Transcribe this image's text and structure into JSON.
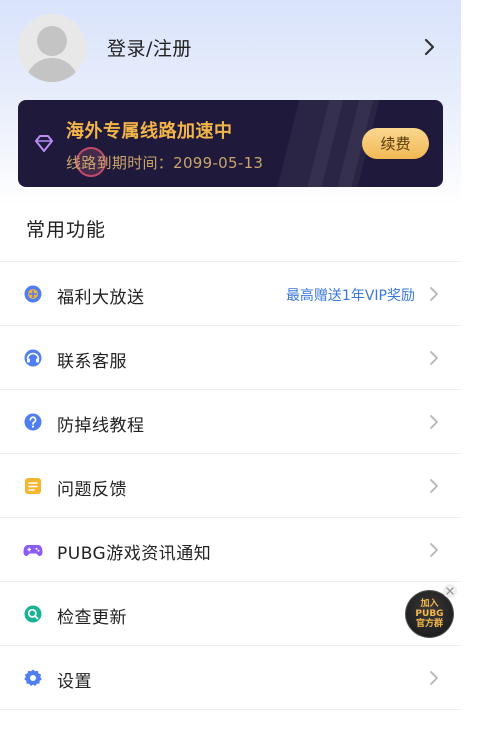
{
  "header": {
    "login_label": "登录/注册"
  },
  "vip_banner": {
    "title": "海外专属线路加速中",
    "expiry": "线路到期时间：2099-05-13",
    "renew_label": "续费"
  },
  "section": {
    "title": "常用功能"
  },
  "menu": [
    {
      "label": "福利大放送",
      "extra": "最高赠送1年VIP奖励",
      "icon": "gift-globe-icon"
    },
    {
      "label": "联系客服",
      "icon": "customer-service-icon"
    },
    {
      "label": "防掉线教程",
      "icon": "help-question-icon"
    },
    {
      "label": "问题反馈",
      "icon": "feedback-note-icon"
    },
    {
      "label": "PUBG游戏资讯通知",
      "icon": "gamepad-icon"
    },
    {
      "label": "检查更新",
      "icon": "update-search-icon"
    },
    {
      "label": "设置",
      "icon": "gear-icon"
    }
  ],
  "floating_badge": {
    "line1": "加入",
    "line2": "PUBG",
    "line3": "官方群"
  },
  "colors": {
    "vip_gold": "#f3b548",
    "link_blue": "#3a78e0",
    "banner_bg": "#1f1a3c"
  }
}
